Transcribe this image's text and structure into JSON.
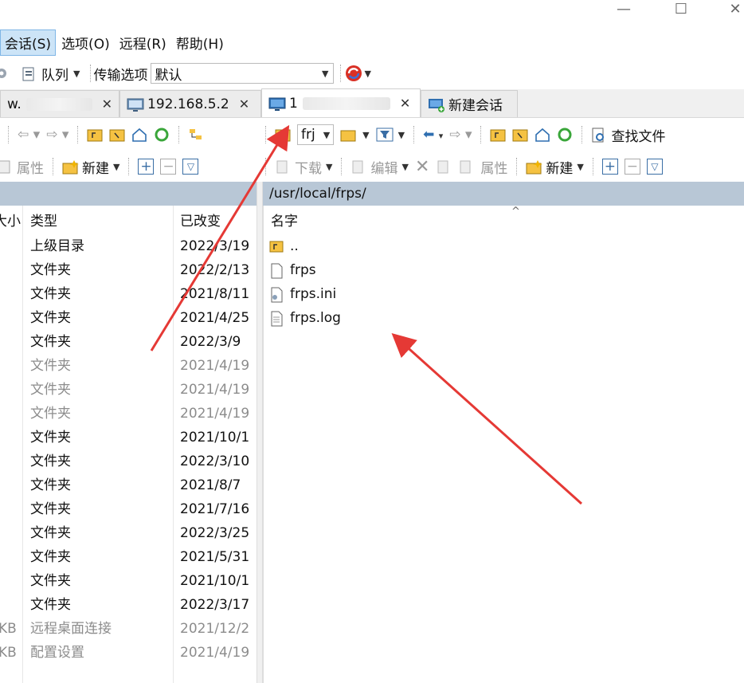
{
  "window": {
    "minimize_glyph": "—",
    "maximize_glyph": "☐",
    "close_glyph": "✕"
  },
  "menu": [
    "会话(S)",
    "选项(O)",
    "远程(R)",
    "帮助(H)"
  ],
  "toolbar": {
    "queue_label": "队列",
    "transfer_label": "传输选项",
    "transfer_value": "默认"
  },
  "tabs": {
    "tab1_label": "w.",
    "tab2_label": "192.168.5.2",
    "tab3_label": "1",
    "new_session_label": "新建会话",
    "close_glyph": "✕"
  },
  "left_toolbar": {
    "properties": "属性",
    "new": "新建"
  },
  "right_toolbar": {
    "path_combo": "frj",
    "find_files": "查找文件",
    "download": "下载",
    "edit": "编辑",
    "properties": "属性",
    "new": "新建"
  },
  "right_pane": {
    "path": "/usr/local/frps/",
    "column_name": "名字",
    "files": [
      {
        "name": "..",
        "icon": "parent-dir-icon"
      },
      {
        "name": "frps",
        "icon": "file-icon"
      },
      {
        "name": "frps.ini",
        "icon": "config-file-icon"
      },
      {
        "name": "frps.log",
        "icon": "text-file-icon"
      }
    ]
  },
  "left_pane": {
    "columns": {
      "size": "大小",
      "type": "类型",
      "modified": "已改变"
    },
    "rows": [
      {
        "size": "",
        "type": "上级目录",
        "modified": "2022/3/19",
        "dim": false
      },
      {
        "size": "",
        "type": "文件夹",
        "modified": "2022/2/13",
        "dim": false
      },
      {
        "size": "",
        "type": "文件夹",
        "modified": "2021/8/11",
        "dim": false
      },
      {
        "size": "",
        "type": "文件夹",
        "modified": "2021/4/25",
        "dim": false
      },
      {
        "size": "",
        "type": "文件夹",
        "modified": "2022/3/9",
        "dim": false
      },
      {
        "size": "",
        "type": "文件夹",
        "modified": "2021/4/19",
        "dim": true
      },
      {
        "size": "",
        "type": "文件夹",
        "modified": "2021/4/19",
        "dim": true
      },
      {
        "size": "",
        "type": "文件夹",
        "modified": "2021/4/19",
        "dim": true
      },
      {
        "size": "",
        "type": "文件夹",
        "modified": "2021/10/1",
        "dim": false
      },
      {
        "size": "",
        "type": "文件夹",
        "modified": "2022/3/10",
        "dim": false
      },
      {
        "size": "",
        "type": "文件夹",
        "modified": "2021/8/7",
        "dim": false
      },
      {
        "size": "",
        "type": "文件夹",
        "modified": "2021/7/16",
        "dim": false
      },
      {
        "size": "",
        "type": "文件夹",
        "modified": "2022/3/25",
        "dim": false
      },
      {
        "size": "",
        "type": "文件夹",
        "modified": "2021/5/31",
        "dim": false
      },
      {
        "size": "",
        "type": "文件夹",
        "modified": "2021/10/1",
        "dim": false
      },
      {
        "size": "",
        "type": "文件夹",
        "modified": "2022/3/17",
        "dim": false
      },
      {
        "size": "KB",
        "type": "远程桌面连接",
        "modified": "2021/12/2",
        "dim": true
      },
      {
        "size": "KB",
        "type": "配置设置",
        "modified": "2021/4/19",
        "dim": true
      }
    ]
  },
  "colors": {
    "accent_tab": "#ffffff",
    "path_bar": "#b8c7d6",
    "annotation_arrow": "#e53935"
  }
}
